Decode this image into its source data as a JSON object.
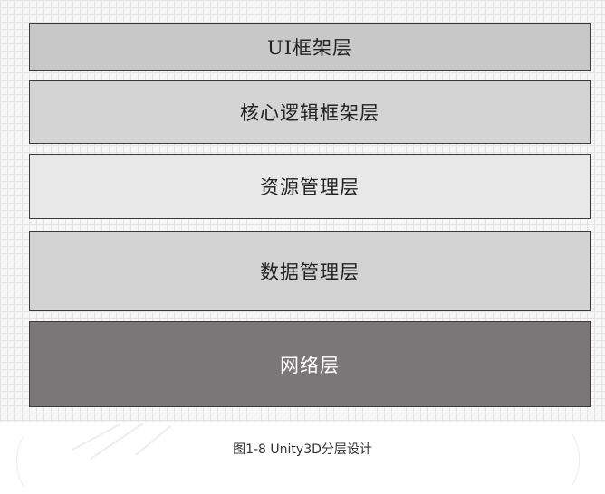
{
  "layers": [
    {
      "label": "UI框架层",
      "fill": "#c8c8c8",
      "text_color": "#222222"
    },
    {
      "label": "核心逻辑框架层",
      "fill": "#d4d4d4",
      "text_color": "#222222"
    },
    {
      "label": "资源管理层",
      "fill": "#e8e8e8",
      "text_color": "#222222"
    },
    {
      "label": "数据管理层",
      "fill": "#d2d2d2",
      "text_color": "#222222"
    },
    {
      "label": "网络层",
      "fill": "#7a7778",
      "text_color": "#ffffff"
    }
  ],
  "caption": "图1-8 Unity3D分层设计"
}
